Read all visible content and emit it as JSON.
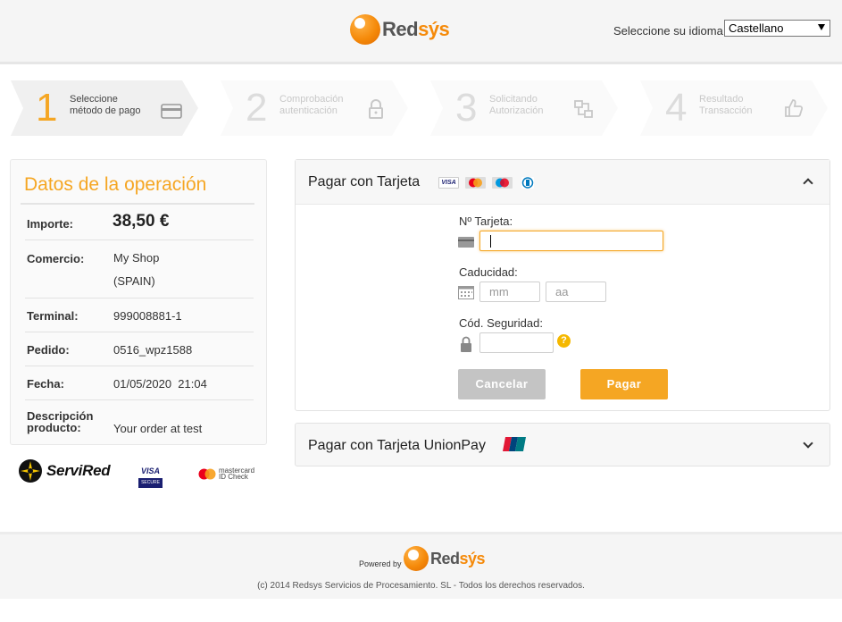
{
  "brand": {
    "logo_part1": "Red",
    "logo_part2": "sýs"
  },
  "language": {
    "label": "Seleccione su idioma",
    "selected": "Castellano"
  },
  "steps": [
    {
      "number": "1",
      "line1": "Seleccione",
      "line2": "método de pago",
      "icon": "card-icon"
    },
    {
      "number": "2",
      "line1": "Comprobación",
      "line2": "autenticación",
      "icon": "lock-icon"
    },
    {
      "number": "3",
      "line1": "Solicitando",
      "line2": "Autorización",
      "icon": "exchange-icon"
    },
    {
      "number": "4",
      "line1": "Resultado",
      "line2": "Transacción",
      "icon": "thumbs-up-icon"
    }
  ],
  "operation": {
    "title": "Datos de la operación",
    "rows": [
      {
        "key": "Importe:",
        "value": "38,50 €"
      },
      {
        "key": "Comercio:",
        "value_line1": "My Shop",
        "value_line2": "(SPAIN)"
      },
      {
        "key": "Terminal:",
        "value": "999008881-1"
      },
      {
        "key": "Pedido:",
        "value": "0516_wpz1588"
      },
      {
        "key": "Fecha:",
        "value": "01/05/2020  21:04"
      },
      {
        "key_line1": "Descripción",
        "key_line2": "producto:",
        "value": "Your order at test"
      }
    ]
  },
  "card_payment": {
    "title": "Pagar con Tarjeta",
    "card_number_label": "Nº Tarjeta:",
    "card_number_value": "",
    "expiry_label": "Caducidad:",
    "month_placeholder": "mm",
    "year_placeholder": "aa",
    "cvv_label": "Cód. Seguridad:",
    "help": "?",
    "cancel_label": "Cancelar",
    "pay_label": "Pagar"
  },
  "unionpay": {
    "title": "Pagar con Tarjeta UnionPay"
  },
  "security": {
    "servired": "ServiRed",
    "visa": "VISA",
    "visa_sub": "SECURE",
    "mc_line1": "mastercard",
    "mc_line2": "ID Check"
  },
  "footer": {
    "powered": "Powered by",
    "copyright": "(c) 2014 Redsys Servicios de Procesamiento. SL - Todos los derechos reservados."
  },
  "colors": {
    "accent": "#f5a623",
    "cancel": "#c4c4c4"
  }
}
